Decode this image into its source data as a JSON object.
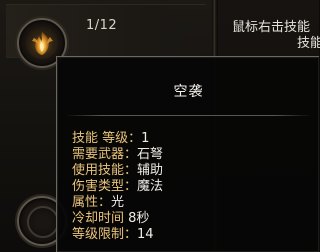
{
  "skill_bar": {
    "level": "1/12",
    "hint_line1": "鼠标右击技能",
    "hint_line2": "技能"
  },
  "tooltip": {
    "title": "空袭",
    "attributes": [
      {
        "label": "技能 等级：",
        "value": "1"
      },
      {
        "label": "需要武器：",
        "value": "石弩"
      },
      {
        "label": "使用技能：",
        "value": "辅助"
      },
      {
        "label": "伤害类型：",
        "value": "魔法"
      },
      {
        "label": "属性：",
        "value": "光"
      },
      {
        "label": "冷却时间 ",
        "value": "8秒"
      },
      {
        "label": "等级限制：",
        "value": "14"
      }
    ]
  },
  "icons": {
    "skill_top": "fire-bird-skill-icon",
    "skill_bottom": "empty-skill-slot-icon"
  },
  "colors": {
    "attribute_label": "#e9c47a",
    "attribute_value": "#efece4",
    "tooltip_border": "#6c6760"
  }
}
